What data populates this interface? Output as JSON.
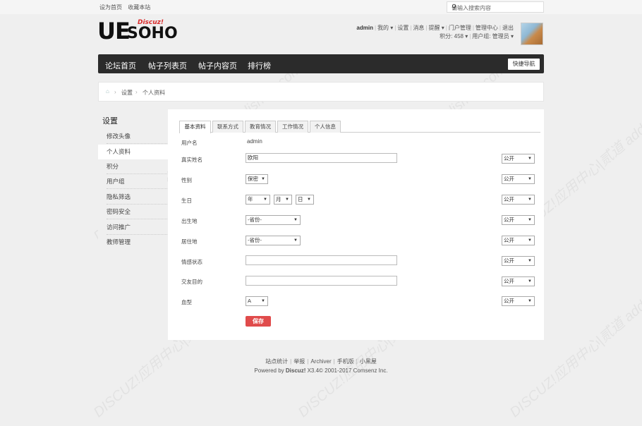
{
  "topbar": {
    "set_home": "设为首页",
    "bookmark": "收藏本站",
    "search_placeholder": "请输入搜索内容"
  },
  "logo": {
    "main": "UE",
    "sub": "SOHO",
    "tag": "Discuz!"
  },
  "user": {
    "name": "admin",
    "links": [
      "我的",
      "设置",
      "消息",
      "提醒",
      "门户管理",
      "管理中心",
      "退出"
    ],
    "points": "积分: 458",
    "group": "用户组: 管理员"
  },
  "nav": {
    "items": [
      "论坛首页",
      "帖子列表页",
      "帖子内容页",
      "排行榜"
    ],
    "quick": "快捷导航"
  },
  "breadcrumb": {
    "current_section": "设置",
    "page": "个人资料"
  },
  "sidebar": {
    "title": "设置",
    "items": [
      "修改头像",
      "个人资料",
      "积分",
      "用户组",
      "隐私筛选",
      "密码安全",
      "访问推广",
      "教师管理"
    ],
    "active_index": 1
  },
  "tabs": [
    "基本资料",
    "联系方式",
    "教育情况",
    "工作情况",
    "个人信息"
  ],
  "form": {
    "username_label": "用户名",
    "username_value": "admin",
    "realname_label": "真实姓名",
    "realname_value": "欧阳",
    "gender_label": "性别",
    "gender_value": "保密",
    "birthday_label": "生日",
    "year": "年",
    "month": "月",
    "day": "日",
    "birthplace_label": "出生地",
    "residence_label": "居住地",
    "province_placeholder": "-省份-",
    "relationship_label": "情感状态",
    "relationship_value": "",
    "purpose_label": "交友目的",
    "purpose_value": "",
    "blood_label": "血型",
    "blood_value": "A",
    "privacy_value": "公开",
    "save": "保存"
  },
  "footer": {
    "links": [
      "站点统计",
      "举报",
      "Archiver",
      "手机版",
      "小黑屋"
    ],
    "powered_prefix": "Powered by",
    "powered_brand": "Discuz!",
    "powered_suffix": "X3.4© 2001-2017 Comsenz Inc."
  },
  "watermark": "DISCUZ!应用中心|贰道 addon.dismall.com"
}
